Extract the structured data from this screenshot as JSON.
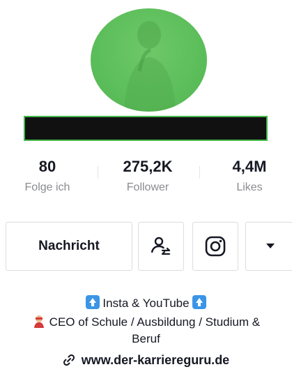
{
  "profile": {
    "stats": [
      {
        "value": "80",
        "label": "Folge ich"
      },
      {
        "value": "275,2K",
        "label": "Follower"
      },
      {
        "value": "4,4M",
        "label": "Likes"
      }
    ]
  },
  "actions": {
    "message_label": "Nachricht",
    "icons": [
      "add-friend-icon",
      "instagram-icon",
      "dropdown-arrow-icon"
    ]
  },
  "bio": {
    "line1": "Insta & YouTube",
    "line2": "CEO of Schule / Ausbildung / Studium &",
    "line3": "Beruf",
    "link": "www.der-karriereguru.de"
  },
  "colors": {
    "avatar_overlay": "#5cbe5b",
    "name_redaction": "#111111",
    "name_border": "#46b84a",
    "muted_text": "#8a8b91"
  }
}
